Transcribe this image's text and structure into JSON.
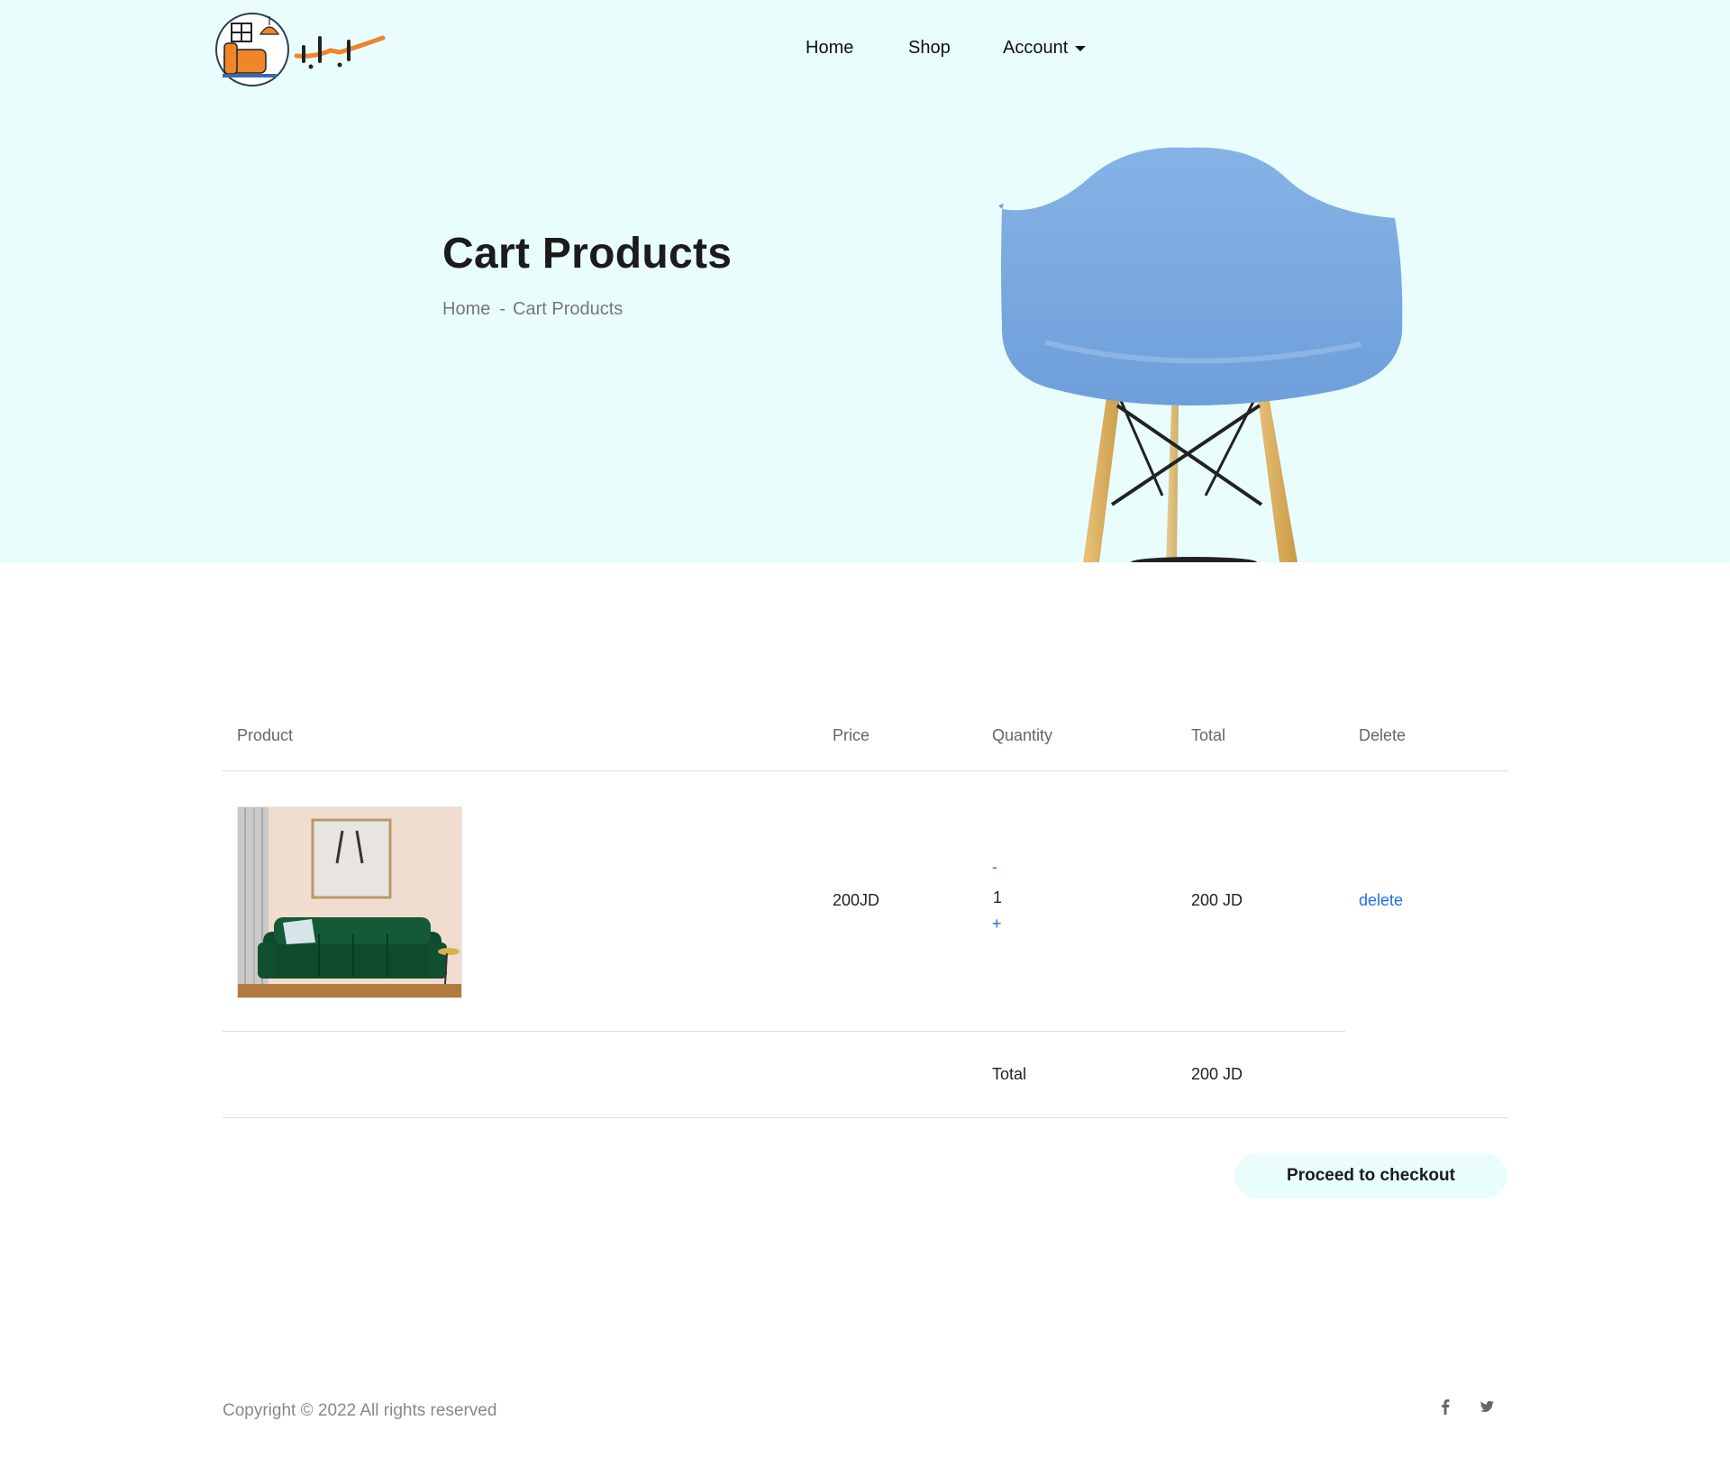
{
  "nav": {
    "home": "Home",
    "shop": "Shop",
    "account": "Account"
  },
  "hero": {
    "title": "Cart Products",
    "breadcrumb": {
      "home": "Home",
      "separator": "-",
      "current": "Cart Products"
    }
  },
  "cart": {
    "headers": {
      "product": "Product",
      "price": "Price",
      "quantity": "Quantity",
      "total": "Total",
      "delete": "Delete"
    },
    "items": [
      {
        "image": "green-velvet-sofa-photo",
        "price": "200JD",
        "decrement": "-",
        "quantity": "1",
        "increment": "+",
        "total": "200 JD",
        "delete": "delete"
      }
    ],
    "summary": {
      "label": "Total",
      "value": "200 JD"
    },
    "checkout_label": "Proceed to checkout"
  },
  "footer": {
    "copyright": "Copyright © 2022 All rights reserved",
    "social": [
      "facebook-icon",
      "twitter-icon"
    ]
  },
  "colors": {
    "hero_bg": "#e9fdfd",
    "link_blue": "#1f6ee8",
    "chair_blue": "#7aa9e0",
    "logo_orange": "#f0852b"
  }
}
